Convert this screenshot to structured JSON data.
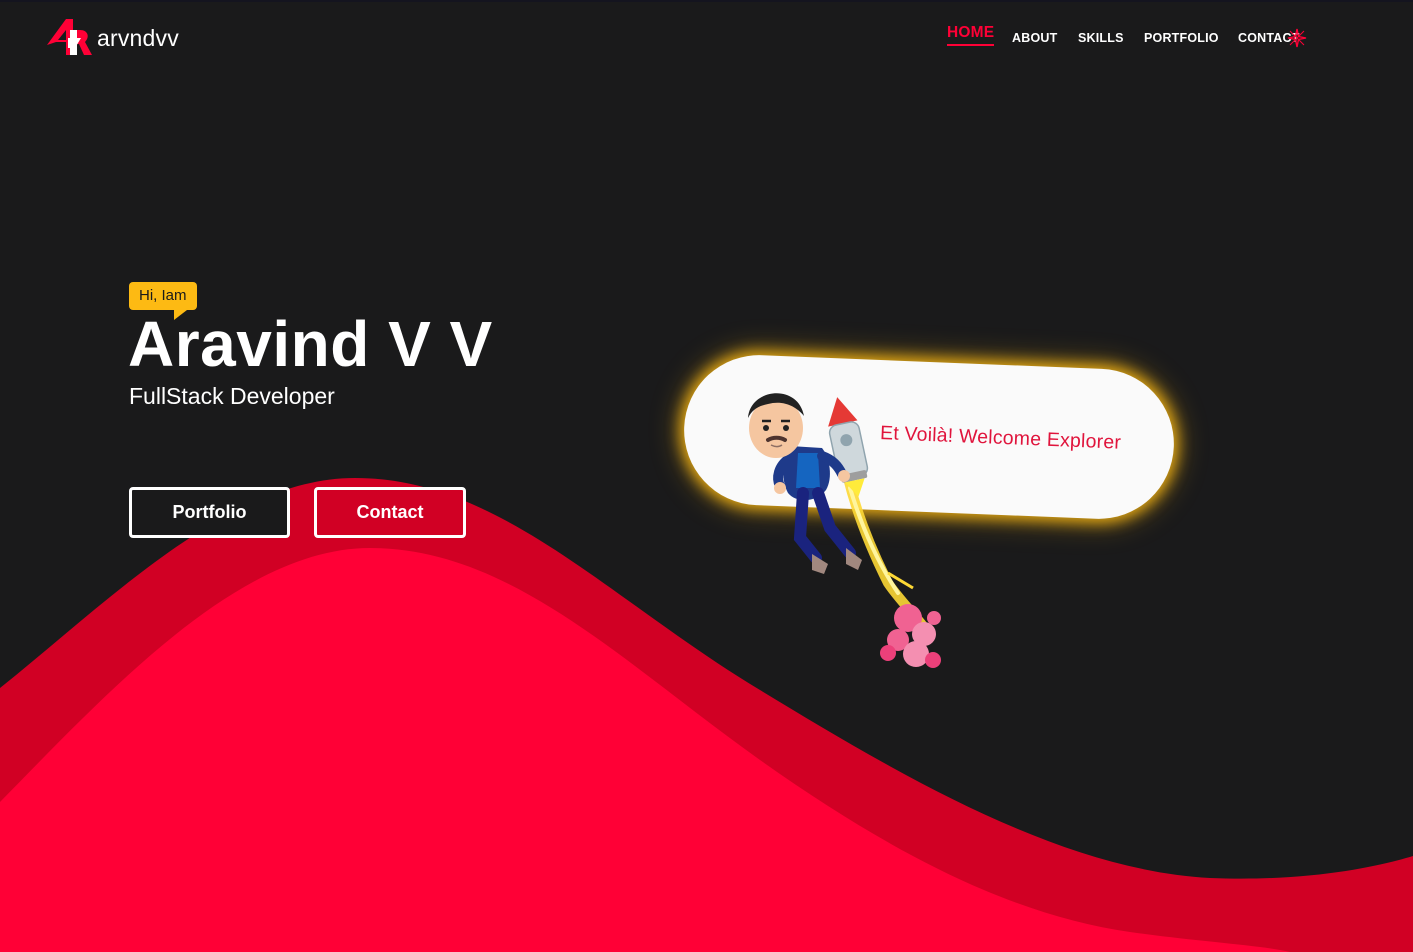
{
  "brand": {
    "name": "arvndvv",
    "logo_icon": "ar-logo-icon"
  },
  "nav": {
    "items": [
      {
        "label": "HOME",
        "active": true
      },
      {
        "label": "ABOUT"
      },
      {
        "label": "SKILLS"
      },
      {
        "label": "PORTFOLIO"
      },
      {
        "label": "CONTACT"
      }
    ],
    "extra_icon": "sparkle-icon"
  },
  "hero": {
    "greeting": "Hi, Iam",
    "name": "Aravind V V",
    "role": "FullStack Developer",
    "buttons": {
      "portfolio": "Portfolio",
      "contact": "Contact"
    }
  },
  "welcome": {
    "message": "Et Voilà! Welcome Explorer",
    "illustration": "jetpack-avatar-icon"
  },
  "colors": {
    "background": "#1a1a1b",
    "accent": "#ff0036",
    "accent_dark": "#d10024",
    "highlight": "#fdba13",
    "text": "#ffffff"
  }
}
